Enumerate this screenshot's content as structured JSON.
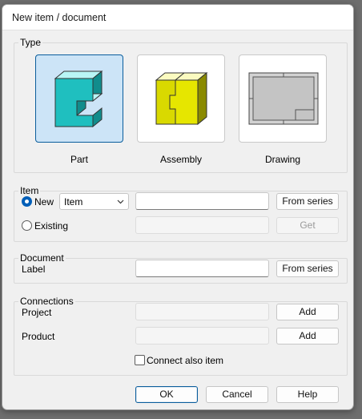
{
  "window": {
    "title": "New item / document"
  },
  "type_group": {
    "label": "Type",
    "tiles": [
      {
        "label": "Part",
        "selected": true,
        "icon": "part-icon"
      },
      {
        "label": "Assembly",
        "selected": false,
        "icon": "assembly-icon"
      },
      {
        "label": "Drawing",
        "selected": false,
        "icon": "drawing-icon"
      }
    ]
  },
  "item_group": {
    "label": "Item",
    "new_label": "New",
    "existing_label": "Existing",
    "select_value": "Item",
    "new_name_value": "",
    "existing_value": "",
    "from_series_label": "From series",
    "get_label": "Get"
  },
  "document_group": {
    "label": "Document",
    "label_field_label": "Label",
    "label_value": "",
    "from_series_label": "From series"
  },
  "connections_group": {
    "label": "Connections",
    "project_label": "Project",
    "project_value": "",
    "product_label": "Product",
    "product_value": "",
    "add_label": "Add",
    "connect_also_label": "Connect also item"
  },
  "footer": {
    "ok_label": "OK",
    "cancel_label": "Cancel",
    "help_label": "Help"
  },
  "colors": {
    "accent": "#005fb8",
    "part": "#1fbfbf",
    "assembly": "#d9d900"
  }
}
